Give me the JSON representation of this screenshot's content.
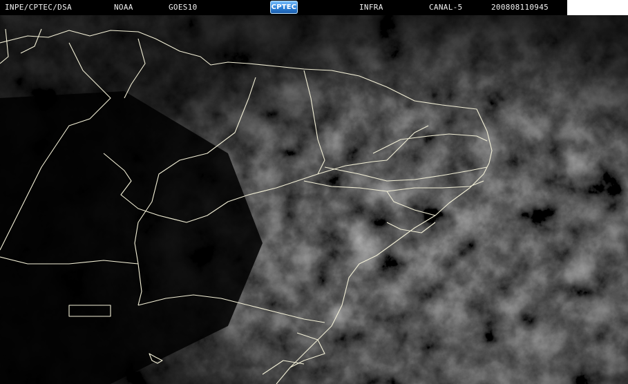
{
  "header": {
    "source": "INPE/CPTEC/DSA",
    "agency": "NOAA",
    "satellite": "GOES10",
    "logo_text": "CPTEC",
    "band": "INFRA",
    "channel": "CANAL-5",
    "timestamp": "200808110945"
  },
  "colors": {
    "background": "#000000",
    "header_text": "#f2f2f2",
    "coastline": "#f4f1d8",
    "cloud_light": "#9a9a9a",
    "cloud_dark": "#3a3a3a"
  }
}
